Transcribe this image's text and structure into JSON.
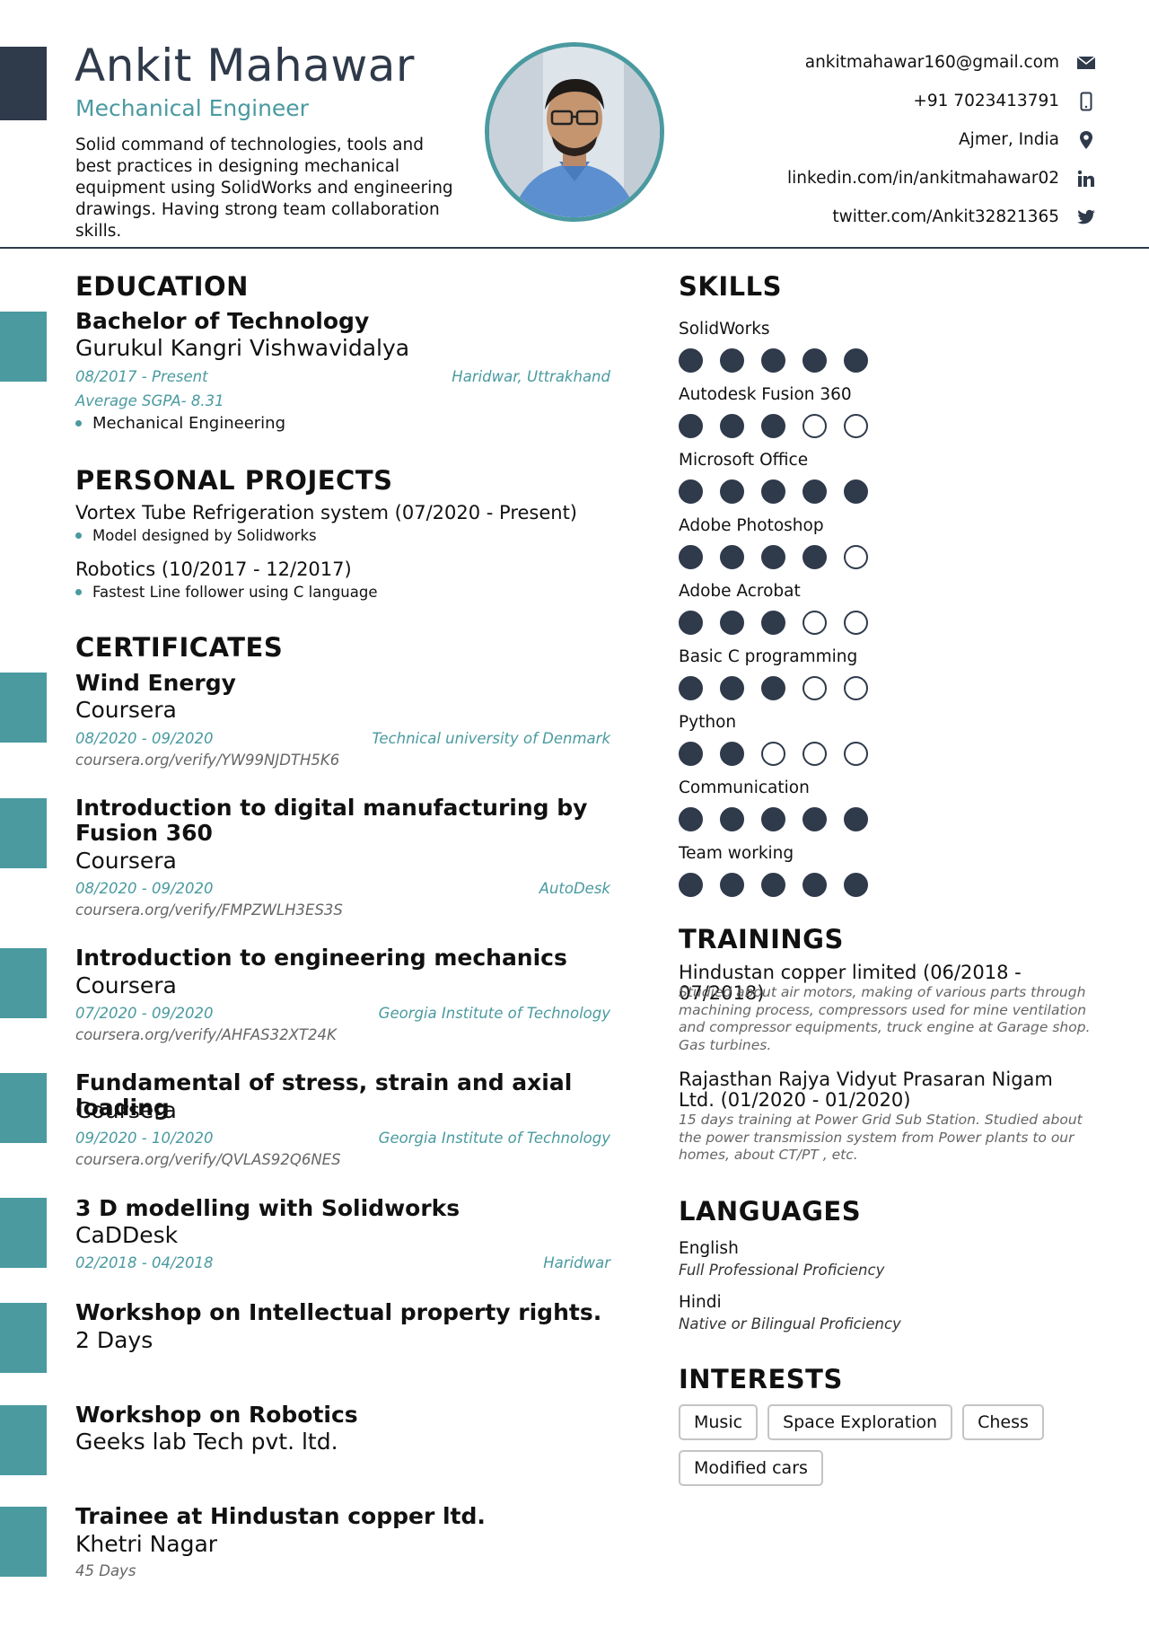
{
  "header": {
    "name": "Ankit Mahawar",
    "role": "Mechanical  Engineer",
    "summary": "Solid command of technologies, tools and best practices in designing mechanical equipment using SolidWorks and engineering drawings. Having strong team collaboration skills."
  },
  "contact": [
    {
      "text": "ankitmahawar160@gmail.com",
      "icon": "envelope-icon"
    },
    {
      "text": "+91 7023413791",
      "icon": "phone-icon"
    },
    {
      "text": "Ajmer, India",
      "icon": "location-pin-icon"
    },
    {
      "text": "linkedin.com/in/ankitmahawar02",
      "icon": "linkedin-icon"
    },
    {
      "text": "twitter.com/Ankit32821365",
      "icon": "twitter-icon"
    }
  ],
  "education": {
    "heading": "EDUCATION",
    "degree": "Bachelor of Technology",
    "school": "Gurukul Kangri Vishwavidalya",
    "dates": "08/2017 - Present",
    "location": "Haridwar, Uttrakhand",
    "gpa": "Average SGPA- 8.31",
    "bullet": "Mechanical Engineering"
  },
  "projects": {
    "heading": "PERSONAL PROJECTS",
    "items": [
      {
        "title": "Vortex Tube Refrigeration system (07/2020 - Present)",
        "bullet": "Model designed by Solidworks"
      },
      {
        "title": "Robotics (10/2017 - 12/2017)",
        "bullet": "Fastest Line follower using C language"
      }
    ]
  },
  "certificates": {
    "heading": "CERTIFICATES",
    "items": [
      {
        "title": "Wind Energy",
        "issuer": "Coursera",
        "dates": "08/2020 - 09/2020",
        "org": "Technical university of Denmark",
        "link": "coursera.org/verify/YW99NJDTH5K6"
      },
      {
        "title": "Introduction to digital manufacturing by Fusion 360",
        "issuer": "Coursera",
        "dates": "08/2020 - 09/2020",
        "org": "AutoDesk",
        "link": "coursera.org/verify/FMPZWLH3ES3S"
      },
      {
        "title": "Introduction to engineering mechanics",
        "issuer": "Coursera",
        "dates": "07/2020 - 09/2020",
        "org": "Georgia Institute of Technology",
        "link": "coursera.org/verify/AHFAS32XT24K"
      },
      {
        "title": "Fundamental of stress, strain and axial loading",
        "issuer": "Coursera",
        "dates": "09/2020 - 10/2020",
        "org": "Georgia Institute of Technology",
        "link": "coursera.org/verify/QVLAS92Q6NES"
      },
      {
        "title": "3 D modelling with Solidworks",
        "issuer": "CaDDesk",
        "dates": "02/2018 - 04/2018",
        "org": "Haridwar"
      },
      {
        "title": "Workshop on Intellectual property rights.",
        "issuer": "2 Days"
      },
      {
        "title": "Workshop on Robotics",
        "issuer": "Geeks lab Tech pvt. ltd."
      },
      {
        "title": "Trainee at Hindustan copper ltd.",
        "issuer": "Khetri Nagar",
        "note": "45 Days"
      }
    ]
  },
  "skills": {
    "heading": "SKILLS",
    "items": [
      {
        "name": "SolidWorks",
        "level": 5,
        "max": 5
      },
      {
        "name": "Autodesk Fusion 360",
        "level": 3,
        "max": 5
      },
      {
        "name": "Microsoft Office",
        "level": 5,
        "max": 5
      },
      {
        "name": "Adobe Photoshop",
        "level": 4,
        "max": 5
      },
      {
        "name": "Adobe Acrobat",
        "level": 3,
        "max": 5
      },
      {
        "name": "Basic C programming",
        "level": 3,
        "max": 5
      },
      {
        "name": "Python",
        "level": 2,
        "max": 5
      },
      {
        "name": "Communication",
        "level": 5,
        "max": 5
      },
      {
        "name": "Team working",
        "level": 5,
        "max": 5
      }
    ]
  },
  "trainings": {
    "heading": "TRAININGS",
    "items": [
      {
        "title": "Hindustan copper limited (06/2018 - 07/2018)",
        "desc": "Studied about air motors, making of various parts through machining process, compressors used for mine ventilation and compressor equipments, truck engine at Garage shop. Gas turbines."
      },
      {
        "title": "Rajasthan Rajya Vidyut Prasaran Nigam Ltd. (01/2020 - 01/2020)",
        "desc": "15 days training at Power Grid Sub Station. Studied about the power transmission system from Power plants to our homes, about CT/PT , etc."
      }
    ]
  },
  "languages": {
    "heading": "LANGUAGES",
    "items": [
      {
        "name": "English",
        "level": "Full Professional Proficiency"
      },
      {
        "name": "Hindi",
        "level": "Native or Bilingual Proficiency"
      }
    ]
  },
  "interests": {
    "heading": "INTERESTS",
    "items": [
      "Music",
      "Space Exploration",
      "Chess",
      "Modified cars"
    ]
  },
  "colors": {
    "accent": "#4a9aa0",
    "dark": "#2f3a4b",
    "muted": "#666666"
  }
}
